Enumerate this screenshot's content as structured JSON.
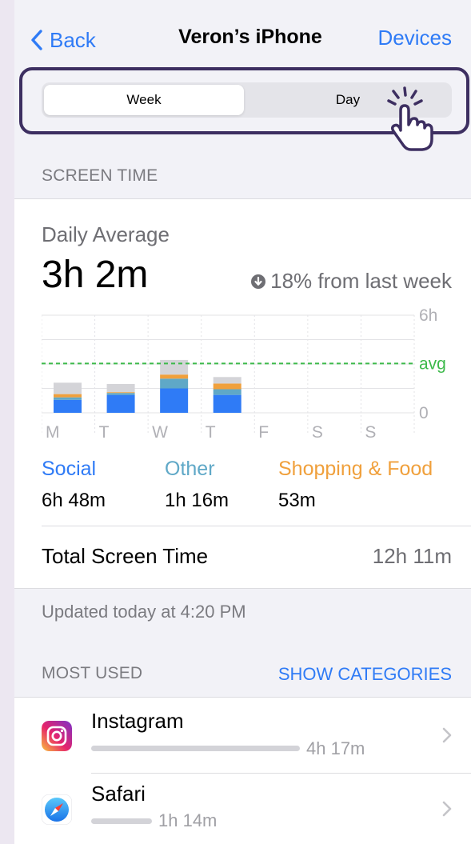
{
  "nav": {
    "back_label": "Back",
    "title": "Veron’s iPhone",
    "devices_label": "Devices"
  },
  "segmented": {
    "options": [
      "Week",
      "Day"
    ],
    "selected": "Week"
  },
  "screen_time": {
    "section_label": "SCREEN TIME",
    "daily_average_label": "Daily Average",
    "daily_average_value": "3h 2m",
    "change_text": "18% from last week",
    "change_direction": "down"
  },
  "chart_data": {
    "type": "bar",
    "categories": [
      "M",
      "T",
      "W",
      "T",
      "F",
      "S",
      "S"
    ],
    "series": [
      {
        "name": "Social",
        "color": "#2f7bf6",
        "values": [
          0.8,
          1.1,
          1.5,
          1.1,
          0,
          0,
          0
        ]
      },
      {
        "name": "Other",
        "color": "#5fa8c7",
        "values": [
          0.15,
          0.12,
          0.6,
          0.35,
          0,
          0,
          0
        ]
      },
      {
        "name": "Shopping & Food",
        "color": "#f0a03c",
        "values": [
          0.2,
          0.05,
          0.25,
          0.35,
          0,
          0,
          0
        ]
      },
      {
        "name": "",
        "color": "#d4d4d8",
        "values": [
          0.7,
          0.5,
          0.9,
          0.4,
          0,
          0,
          0
        ]
      }
    ],
    "ylim": [
      0,
      6
    ],
    "y_ticks": [
      "6h",
      "avg",
      "0"
    ],
    "avg_value": 3.03,
    "grid": true
  },
  "legend": [
    {
      "label": "Social",
      "value": "6h 48m",
      "color": "#2f7bf6"
    },
    {
      "label": "Other",
      "value": "1h 16m",
      "color": "#5fa8c7"
    },
    {
      "label": "Shopping & Food",
      "value": "53m",
      "color": "#f0a03c"
    }
  ],
  "total": {
    "label": "Total Screen Time",
    "value": "12h 11m"
  },
  "updated_text": "Updated today at 4:20 PM",
  "most_used": {
    "section_label": "MOST USED",
    "show_categories_label": "SHOW CATEGORIES",
    "apps": [
      {
        "name": "Instagram",
        "usage": "4h 17m",
        "fraction": 0.55
      },
      {
        "name": "Safari",
        "usage": "1h 14m",
        "fraction": 0.16
      }
    ]
  },
  "colors": {
    "accent": "#2f7bf6",
    "highlight_border": "#3d2f61",
    "avg_line": "#3cb94a"
  }
}
